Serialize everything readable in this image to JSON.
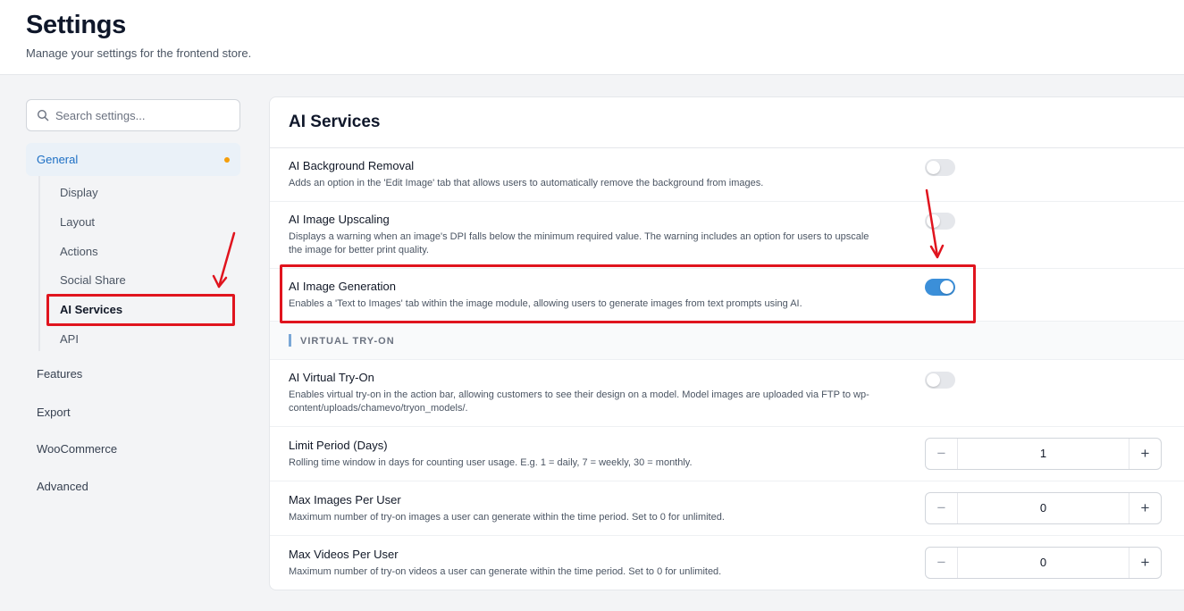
{
  "header": {
    "title": "Settings",
    "subtitle": "Manage your settings for the frontend store."
  },
  "sidebar": {
    "search_placeholder": "Search settings...",
    "general": {
      "label": "General",
      "indicator_color": "#f59e0b"
    },
    "subitems": [
      "Display",
      "Layout",
      "Actions",
      "Social Share",
      "AI Services",
      "API"
    ],
    "active_subitem": "AI Services",
    "items": [
      "Features",
      "Export",
      "WooCommerce",
      "Advanced"
    ]
  },
  "panel": {
    "title": "AI Services",
    "settings": [
      {
        "title": "AI Background Removal",
        "desc": "Adds an option in the 'Edit Image' tab that allows users to automatically remove the background from images.",
        "enabled": false
      },
      {
        "title": "AI Image Upscaling",
        "desc": "Displays a warning when an image's DPI falls below the minimum required value. The warning includes an option for users to upscale the image for better print quality.",
        "enabled": false
      },
      {
        "title": "AI Image Generation",
        "desc": "Enables a 'Text to Images' tab within the image module, allowing users to generate images from text prompts using AI.",
        "enabled": true
      }
    ],
    "section": {
      "label": "VIRTUAL TRY-ON"
    },
    "tryon": {
      "title": "AI Virtual Try-On",
      "desc": "Enables virtual try-on in the action bar, allowing customers to see their design on a model. Model images are uploaded via FTP to wp-content/uploads/chamevo/tryon_models/.",
      "enabled": false
    },
    "numeric": [
      {
        "title": "Limit Period (Days)",
        "desc": "Rolling time window in days for counting user usage. E.g. 1 = daily, 7 = weekly, 30 = monthly.",
        "value": "1"
      },
      {
        "title": "Max Images Per User",
        "desc": "Maximum number of try-on images a user can generate within the time period. Set to 0 for unlimited.",
        "value": "0"
      },
      {
        "title": "Max Videos Per User",
        "desc": "Maximum number of try-on videos a user can generate within the time period. Set to 0 for unlimited.",
        "value": "0"
      }
    ],
    "stepper_minus": "−",
    "stepper_plus": "+"
  },
  "colors": {
    "accent": "#3b8fd9",
    "active_nav_text": "#1d6fc4",
    "annotation_red": "#e0141e"
  }
}
